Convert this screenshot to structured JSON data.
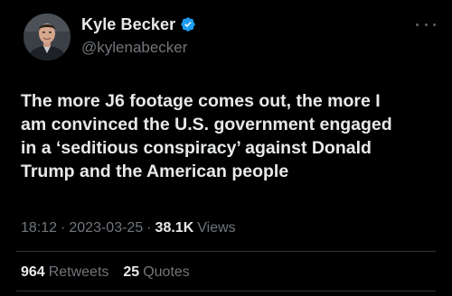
{
  "user": {
    "display_name": "Kyle Becker",
    "handle": "@kylenabecker",
    "verified": true
  },
  "tweet": {
    "text": "The more J6 footage comes out, the more I\nam convinced the U.S. government engaged\nin a ‘seditious conspiracy’ against Donald\nTrump and the American people"
  },
  "meta": {
    "time": "18:12",
    "sep1": "·",
    "date": "2023-03-25",
    "sep2": "·",
    "views_count": "38.1K",
    "views_label": "Views"
  },
  "stats": {
    "retweets_count": "964",
    "retweets_label": "Retweets",
    "quotes_count": "25",
    "quotes_label": "Quotes"
  },
  "colors": {
    "background": "#000000",
    "text_primary": "#e7e9ea",
    "text_secondary": "#71767b",
    "verified": "#1d9bf0",
    "divider": "#2f3336"
  },
  "icons": {
    "verified": "verified-badge-icon",
    "more": "more-options-icon"
  }
}
